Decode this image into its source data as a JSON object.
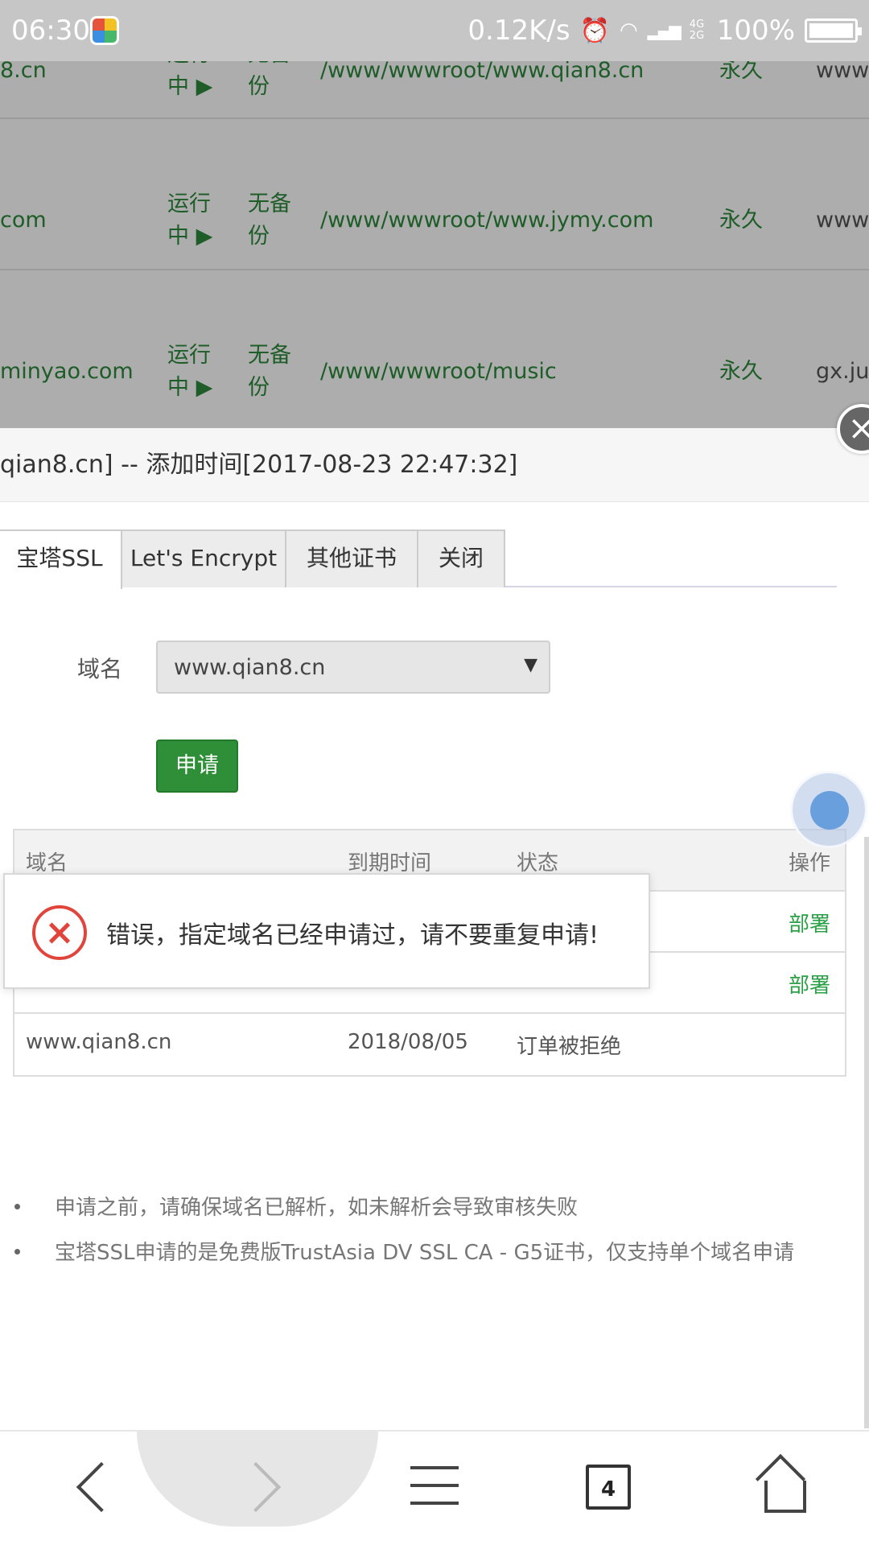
{
  "status_bar": {
    "time": "06:30",
    "net_speed": "0.12K/s",
    "network_type": "4G 2G",
    "battery": "100%",
    "icons": [
      "app-icon",
      "alarm-icon",
      "wifi-icon",
      "signal-icon",
      "battery-icon"
    ]
  },
  "site_list": [
    {
      "domain": "8.cn",
      "status_line1": "运行",
      "status_line2": "中 ▶",
      "backup_line1": "无备",
      "backup_line2": "份",
      "path": "/www/wwwroot/www.qian8.cn",
      "expire": "永久",
      "extra": "www."
    },
    {
      "domain": "com",
      "status_line1": "运行",
      "status_line2": "中 ▶",
      "backup_line1": "无备",
      "backup_line2": "份",
      "path": "/www/wwwroot/www.jymy.com",
      "expire": "永久",
      "extra": "www."
    },
    {
      "domain": "minyao.com",
      "status_line1": "运行",
      "status_line2": "中 ▶",
      "backup_line1": "无备",
      "backup_line2": "份",
      "path": "/www/wwwroot/music",
      "expire": "永久",
      "extra": "gx.jun"
    }
  ],
  "modal": {
    "title": "qian8.cn] -- 添加时间[2017-08-23 22:47:32]",
    "close_glyph": "×",
    "tabs": [
      "宝塔SSL",
      "Let's Encrypt",
      "其他证书",
      "关闭"
    ],
    "domain_label": "域名",
    "domain_selected": "www.qian8.cn",
    "select_arrow": "▼",
    "apply_button": "申请",
    "table": {
      "headers": [
        "域名",
        "到期时间",
        "状态",
        "操作"
      ],
      "rows": [
        {
          "domain": "",
          "expire": "",
          "status": "",
          "action": "部署"
        },
        {
          "domain": "",
          "expire": "",
          "status": "",
          "action": "部署"
        },
        {
          "domain": "www.qian8.cn",
          "expire": "2018/08/05",
          "status": "订单被拒绝",
          "action": ""
        }
      ]
    },
    "error_message": "错误，指定域名已经申请过，请不要重复申请!",
    "tips": [
      "申请之前，请确保域名已解析，如未解析会导致审核失败",
      "宝塔SSL申请的是免费版TrustAsia DV SSL CA - G5证书，仅支持单个域名申请"
    ]
  },
  "bottom_nav": {
    "tab_count": "4"
  }
}
